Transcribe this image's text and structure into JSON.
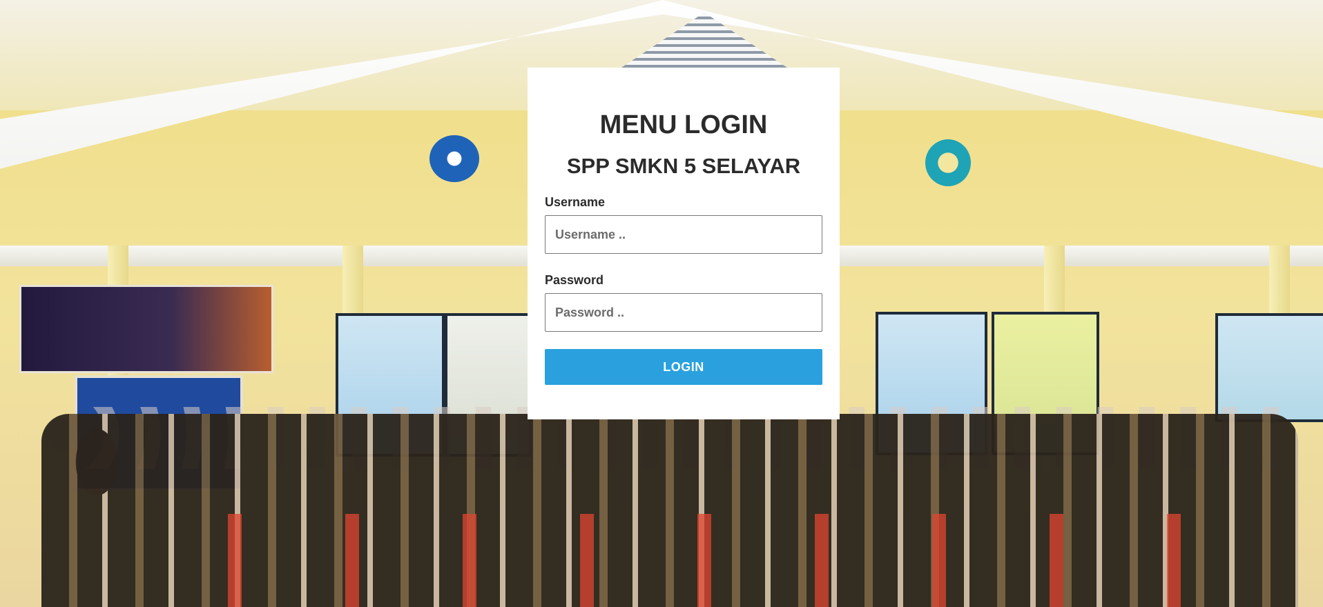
{
  "login": {
    "title": "MENU LOGIN",
    "subtitle": "SPP SMKN 5 SELAYAR",
    "username_label": "Username",
    "username_placeholder": "Username ..",
    "username_value": "",
    "password_label": "Password",
    "password_placeholder": "Password ..",
    "password_value": "",
    "button_label": "LOGIN"
  },
  "colors": {
    "button_bg": "#2aa1de",
    "card_bg": "#ffffff",
    "text": "#2b2b2b"
  }
}
